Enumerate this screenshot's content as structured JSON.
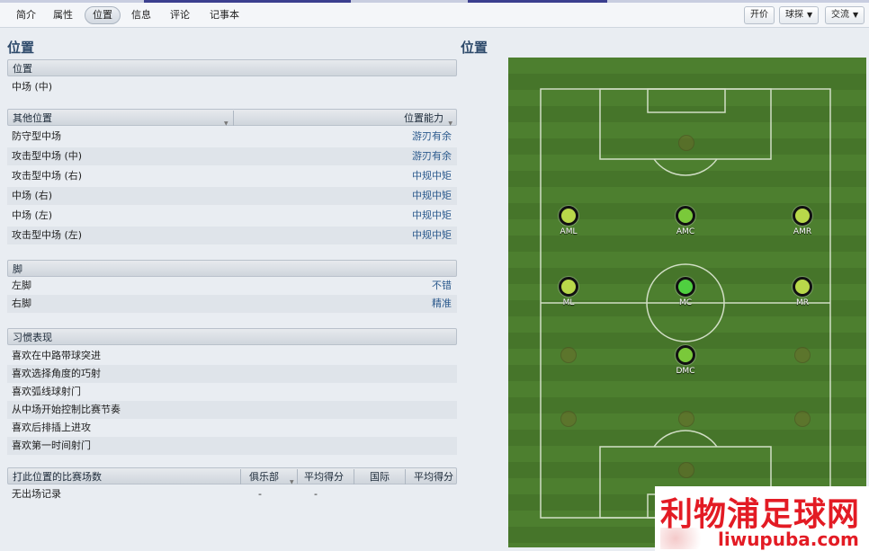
{
  "tabs": [
    "简介",
    "属性",
    "位置",
    "信息",
    "评论",
    "记事本"
  ],
  "active_tab": "位置",
  "toolbar_buttons": {
    "offer": "开价",
    "scout": "球探",
    "interact": "交流"
  },
  "left_heading": "位置",
  "right_heading": "位置",
  "position_section": {
    "title": "位置",
    "value": "中场 (中)"
  },
  "other_positions": {
    "col_left": "其他位置",
    "col_right": "位置能力",
    "rows": [
      {
        "name": "防守型中场",
        "ability": "游刃有余"
      },
      {
        "name": "攻击型中场 (中)",
        "ability": "游刃有余"
      },
      {
        "name": "攻击型中场 (右)",
        "ability": "中规中矩"
      },
      {
        "name": "中场 (右)",
        "ability": "中规中矩"
      },
      {
        "name": "中场 (左)",
        "ability": "中规中矩"
      },
      {
        "name": "攻击型中场 (左)",
        "ability": "中规中矩"
      }
    ]
  },
  "foot": {
    "title": "脚",
    "rows": [
      {
        "name": "左脚",
        "value": "不错"
      },
      {
        "name": "右脚",
        "value": "精准"
      }
    ]
  },
  "habits": {
    "title": "习惯表现",
    "items": [
      "喜欢在中路带球突进",
      "喜欢选择角度的巧射",
      "喜欢弧线球射门",
      "从中场开始控制比赛节奏",
      "喜欢后排插上进攻",
      "喜欢第一时间射门"
    ]
  },
  "stats": {
    "headers": [
      "打此位置的比赛场数",
      "俱乐部",
      "平均得分",
      "国际",
      "平均得分"
    ],
    "row": {
      "label": "无出场记录",
      "club": "-",
      "club_avg": "-"
    }
  },
  "pitch_positions": [
    {
      "label": "AML",
      "color": "#b9d84a"
    },
    {
      "label": "AMC",
      "color": "#7ac93a"
    },
    {
      "label": "AMR",
      "color": "#b9d84a"
    },
    {
      "label": "ML",
      "color": "#b9d84a"
    },
    {
      "label": "MC",
      "color": "#4fd040"
    },
    {
      "label": "MR",
      "color": "#b9d84a"
    },
    {
      "label": "DMC",
      "color": "#7ac93a"
    }
  ],
  "watermark": {
    "cn": "利物浦足球网",
    "en": "liwupuba.com"
  }
}
